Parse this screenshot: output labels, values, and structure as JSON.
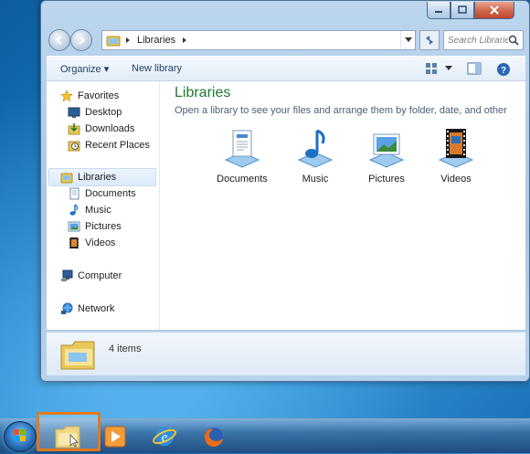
{
  "window": {
    "caption_buttons": [
      "minimize",
      "maximize",
      "close"
    ]
  },
  "address_bar": {
    "path": "Libraries",
    "refresh_icon": "refresh-icon"
  },
  "search": {
    "placeholder": "Search Libraries"
  },
  "toolbar": {
    "organize_label": "Organize ▾",
    "new_library_label": "New library"
  },
  "nav_pane": {
    "favorites": {
      "label": "Favorites",
      "items": [
        "Desktop",
        "Downloads",
        "Recent Places"
      ]
    },
    "libraries": {
      "label": "Libraries",
      "items": [
        "Documents",
        "Music",
        "Pictures",
        "Videos"
      ]
    },
    "computer": "Computer",
    "network": "Network"
  },
  "main": {
    "title": "Libraries",
    "subtitle": "Open a library to see your files and arrange them by folder, date, and other pr...",
    "libraries": [
      {
        "label": "Documents",
        "icon": "documents-library-icon"
      },
      {
        "label": "Music",
        "icon": "music-library-icon"
      },
      {
        "label": "Pictures",
        "icon": "pictures-library-icon"
      },
      {
        "label": "Videos",
        "icon": "videos-library-icon"
      }
    ]
  },
  "details": {
    "count": "4 items"
  },
  "taskbar": {
    "apps": [
      "windows-explorer",
      "windows-media-player",
      "internet-explorer",
      "firefox"
    ],
    "active": "windows-explorer"
  },
  "colors": {
    "accent_title": "#1e7a2e",
    "taskbar_highlight": "#e07a1c"
  }
}
